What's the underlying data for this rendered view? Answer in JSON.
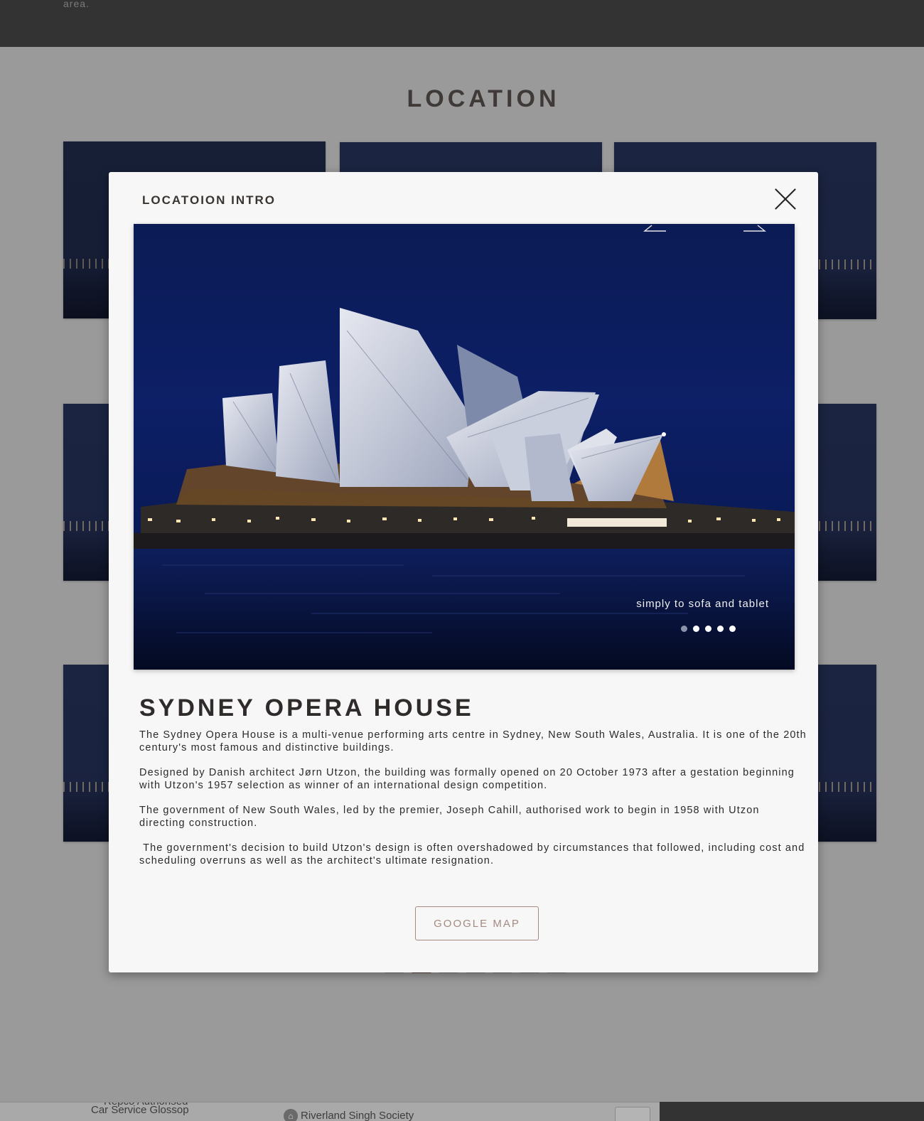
{
  "top": {
    "fade_text": "area."
  },
  "section": {
    "title": "LOCATION"
  },
  "map": {
    "label_cut": "Repco Authorised",
    "label_1": "Car Service Glossop",
    "label_2": "Riverland Singh Society"
  },
  "modal": {
    "title": "LOCATOION INTRO",
    "slider": {
      "caption": "simply to sofa and tablet",
      "total_slides": 5,
      "active_slide": 1
    },
    "heading": "SYDNEY OPERA HOUSE",
    "paragraphs": [
      "The Sydney Opera House is a multi-venue performing arts centre in Sydney, New South Wales, Australia. It is one of the 20th century's most famous and distinctive buildings.",
      "Designed by Danish architect Jørn Utzon, the building was formally opened on 20 October 1973 after a gestation beginning with Utzon's 1957 selection as winner of an international design competition.",
      "The government of New South Wales, led by the premier, Joseph Cahill, authorised work to begin in 1958 with Utzon directing construction.",
      " The government's decision to build Utzon's design is often overshadowed by circumstances that followed, including cost and scheduling overruns as well as the architect's ultimate resignation."
    ],
    "map_button": "GOOGLE MAP"
  },
  "colors": {
    "overlay": "#9a9a9a",
    "dark_band": "#333333",
    "accent": "#a48a80",
    "sky": "#0d1f66"
  },
  "icons": {
    "close": "close-icon",
    "prev": "arrow-left-icon",
    "next": "arrow-right-icon"
  }
}
